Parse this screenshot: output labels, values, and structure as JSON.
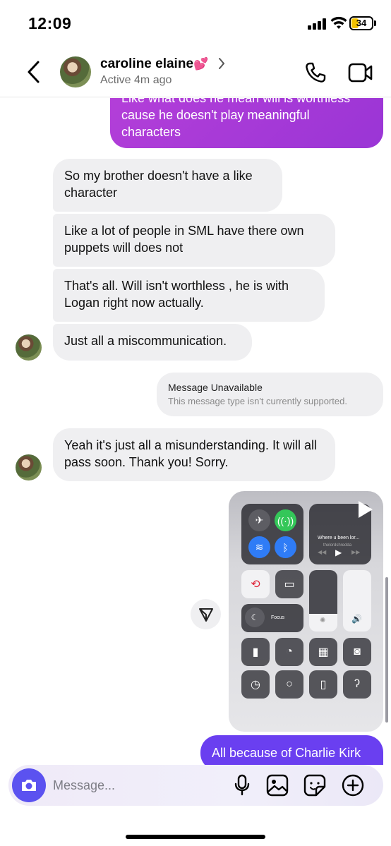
{
  "status_bar": {
    "time": "12:09",
    "battery": "34"
  },
  "header": {
    "name": "caroline elaine",
    "name_emoji": "💕",
    "status": "Active 4m ago"
  },
  "messages": {
    "outgoing_top": "Like what does he mean will is worthless cause he doesn't play meaningful characters",
    "incoming_1": "So my brother doesn't have a like character",
    "incoming_2": "Like a lot of people in SML have there own puppets will does not",
    "incoming_3": "That's all. Will isn't worthless , he is with Logan right now actually.",
    "incoming_4": "Just all a miscommunication.",
    "unavailable_title": "Message Unavailable",
    "unavailable_sub": "This message type isn't currently supported.",
    "incoming_5": "Yeah it's just all a misunderstanding. It will all pass soon. Thank you! Sorry.",
    "outgoing_last": "All because of Charlie Kirk"
  },
  "media": {
    "music_title": "Where u been lor...",
    "music_artist": "thelordshredda",
    "focus_label": "Focus"
  },
  "composer": {
    "placeholder": "Message..."
  },
  "colors": {
    "outgoing_bubble": "#b43fd8",
    "outgoing_bubble_last": "#6a3ff0",
    "incoming_bubble": "#efeff1",
    "camera_button": "#5b52f0"
  },
  "icons": [
    "back-icon",
    "chevron-right-icon",
    "phone-icon",
    "video-icon",
    "share-icon",
    "camera-icon",
    "microphone-icon",
    "gallery-icon",
    "sticker-icon",
    "plus-icon"
  ]
}
